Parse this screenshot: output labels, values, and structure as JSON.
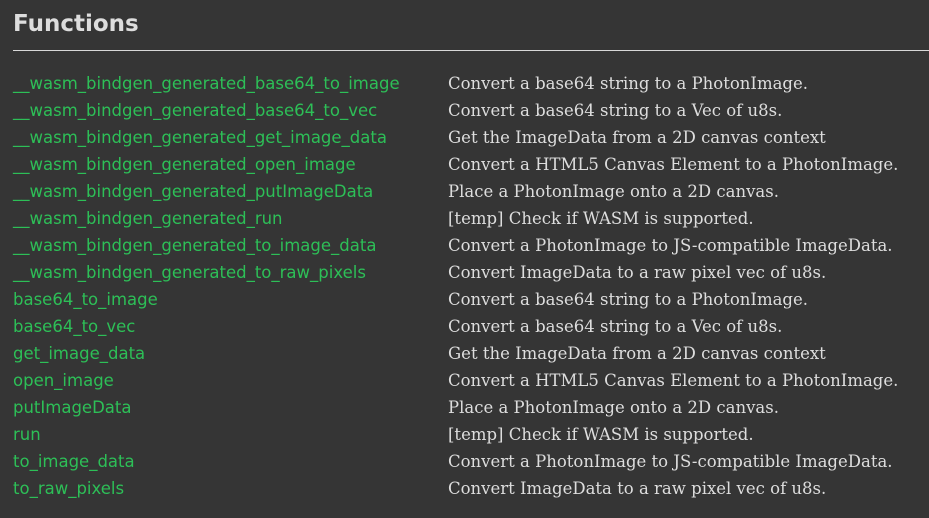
{
  "section": {
    "title": "Functions"
  },
  "colors": {
    "background": "#353535",
    "link": "#2dbf57",
    "text": "#dddddd",
    "rule": "#d8d8d8"
  },
  "functions": [
    {
      "name": "__wasm_bindgen_generated_base64_to_image",
      "desc": "Convert a base64 string to a PhotonImage."
    },
    {
      "name": "__wasm_bindgen_generated_base64_to_vec",
      "desc": "Convert a base64 string to a Vec of u8s."
    },
    {
      "name": "__wasm_bindgen_generated_get_image_data",
      "desc": "Get the ImageData from a 2D canvas context"
    },
    {
      "name": "__wasm_bindgen_generated_open_image",
      "desc": "Convert a HTML5 Canvas Element to a PhotonImage."
    },
    {
      "name": "__wasm_bindgen_generated_putImageData",
      "desc": "Place a PhotonImage onto a 2D canvas."
    },
    {
      "name": "__wasm_bindgen_generated_run",
      "desc": "[temp] Check if WASM is supported."
    },
    {
      "name": "__wasm_bindgen_generated_to_image_data",
      "desc": "Convert a PhotonImage to JS-compatible ImageData."
    },
    {
      "name": "__wasm_bindgen_generated_to_raw_pixels",
      "desc": "Convert ImageData to a raw pixel vec of u8s."
    },
    {
      "name": "base64_to_image",
      "desc": "Convert a base64 string to a PhotonImage."
    },
    {
      "name": "base64_to_vec",
      "desc": "Convert a base64 string to a Vec of u8s."
    },
    {
      "name": "get_image_data",
      "desc": "Get the ImageData from a 2D canvas context"
    },
    {
      "name": "open_image",
      "desc": "Convert a HTML5 Canvas Element to a PhotonImage."
    },
    {
      "name": "putImageData",
      "desc": "Place a PhotonImage onto a 2D canvas."
    },
    {
      "name": "run",
      "desc": "[temp] Check if WASM is supported."
    },
    {
      "name": "to_image_data",
      "desc": "Convert a PhotonImage to JS-compatible ImageData."
    },
    {
      "name": "to_raw_pixels",
      "desc": "Convert ImageData to a raw pixel vec of u8s."
    }
  ]
}
